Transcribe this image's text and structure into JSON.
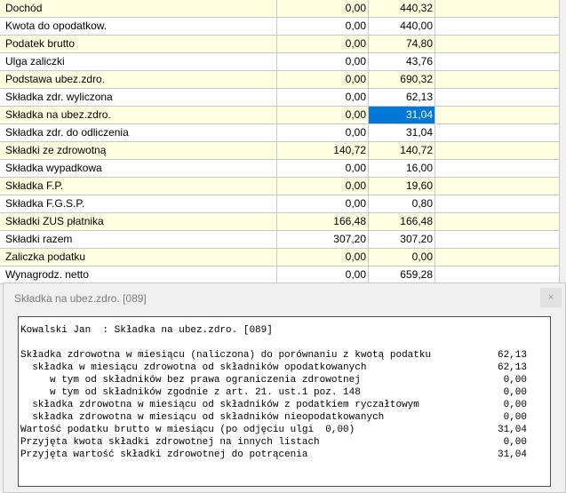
{
  "grid": {
    "rows": [
      {
        "label": "Dochód",
        "v1": "0,00",
        "v2": "440,32",
        "y": true
      },
      {
        "label": "Kwota do opodatkow.",
        "v1": "0,00",
        "v2": "440,00",
        "y": false
      },
      {
        "label": "Podatek brutto",
        "v1": "0,00",
        "v2": "74,80",
        "y": true
      },
      {
        "label": "Ulga zaliczki",
        "v1": "0,00",
        "v2": "43,76",
        "y": false
      },
      {
        "label": "Podstawa ubez.zdro.",
        "v1": "0,00",
        "v2": "690,32",
        "y": true
      },
      {
        "label": "Składka zdr. wyliczona",
        "v1": "0,00",
        "v2": "62,13",
        "y": false
      },
      {
        "label": "Składka na ubez.zdro.",
        "v1": "0,00",
        "v2": "31,04",
        "y": true,
        "selected": true
      },
      {
        "label": "Składka zdr. do odliczenia",
        "v1": "0,00",
        "v2": "31,04",
        "y": false
      },
      {
        "label": "Składki ze zdrowotną",
        "v1": "140,72",
        "v2": "140,72",
        "y": true
      },
      {
        "label": "Składka wypadkowa",
        "v1": "0,00",
        "v2": "16,00",
        "y": false
      },
      {
        "label": "Składka F.P.",
        "v1": "0,00",
        "v2": "19,60",
        "y": true
      },
      {
        "label": "Składka F.G.S.P.",
        "v1": "0,00",
        "v2": "0,80",
        "y": false
      },
      {
        "label": "Składki ZUS płatnika",
        "v1": "166,48",
        "v2": "166,48",
        "y": true
      },
      {
        "label": "Składki razem",
        "v1": "307,20",
        "v2": "307,20",
        "y": false
      },
      {
        "label": "Zaliczka podatku",
        "v1": "0,00",
        "v2": "0,00",
        "y": true
      },
      {
        "label": "Wynagrodz. netto",
        "v1": "0,00",
        "v2": "659,28",
        "y": false
      }
    ]
  },
  "dialog": {
    "title": "Składka na ubez.zdro. [089]",
    "close_label": "×",
    "report": {
      "header": "Kowalski Jan  : Składka na ubez.zdro. [089]",
      "lines": [
        {
          "text": "Składka zdrowotna w miesiącu (naliczona) do porównaniu z kwotą podatku",
          "value": "62,13"
        },
        {
          "text": "  składka w miesiącu zdrowotna od składników opodatkowanych",
          "value": "62,13"
        },
        {
          "text": "     w tym od składników bez prawa ograniczenia zdrowotnej",
          "value": "0,00"
        },
        {
          "text": "     w tym od składników zgodnie z art. 21. ust.1 poz. 148",
          "value": "0,00"
        },
        {
          "text": "  składka zdrowotna w miesiącu od składników z podatkiem ryczałtowym",
          "value": "0,00"
        },
        {
          "text": "  składka zdrowotna w miesiącu od składników nieopodatkowanych",
          "value": "0,00"
        },
        {
          "text": "Wartość podatku brutto w miesiącu (po odjęciu ulgi  0,00)",
          "value": "31,04"
        },
        {
          "text": "Przyjęta kwota składki zdrowotnej na innych listach",
          "value": "0,00"
        },
        {
          "text": "Przyjęta wartość składki zdrowotnej do potrącenia",
          "value": "31,04"
        }
      ]
    }
  }
}
